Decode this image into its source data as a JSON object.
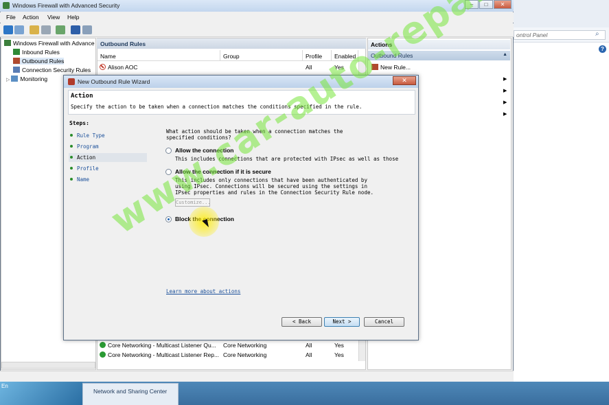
{
  "window": {
    "title": "Windows Firewall with Advanced Security",
    "controls": {
      "minimize": "–",
      "maximize": "□",
      "close": "✕"
    }
  },
  "menu": [
    "File",
    "Action",
    "View",
    "Help"
  ],
  "background_window": {
    "search_placeholder": "ontrol Panel",
    "help": "?"
  },
  "tree": {
    "root": "Windows Firewall with Advance",
    "items": [
      "Inbound Rules",
      "Outbound Rules",
      "Connection Security Rules",
      "Monitoring"
    ]
  },
  "center": {
    "header": "Outbound Rules",
    "columns": [
      "Name",
      "Group",
      "Profile",
      "Enabled"
    ],
    "rows_top": [
      {
        "name": "Alison AOC",
        "group": "",
        "profile": "All",
        "enabled": "Yes"
      }
    ],
    "rows_bottom": [
      {
        "name": "Core Networking - Multicast Listener Qu...",
        "group": "Core Networking",
        "profile": "All",
        "enabled": "Yes"
      },
      {
        "name": "Core Networking - Multicast Listener Rep...",
        "group": "Core Networking",
        "profile": "All",
        "enabled": "Yes"
      }
    ]
  },
  "actions": {
    "header": "Actions",
    "section": "Outbound Rules",
    "items": [
      "New Rule..."
    ]
  },
  "dialog": {
    "title": "New Outbound Rule Wizard",
    "close": "✕",
    "page_title": "Action",
    "page_desc": "Specify the action to be taken when a connection matches the conditions specified in the rule.",
    "steps_title": "Steps:",
    "steps": [
      "Rule Type",
      "Program",
      "Action",
      "Profile",
      "Name"
    ],
    "current_step": 2,
    "question": "What action should be taken when a connection matches the specified conditions?",
    "options": [
      {
        "label": "Allow the connection",
        "desc": "This includes connections that are protected with IPsec as well as those",
        "selected": false
      },
      {
        "label": "Allow the connection if it is secure",
        "desc": "This includes only connections that have been authenticated by using IPsec.  Connections will be secured using the settings in IPsec properties and rules in the Connection Security Rule node.",
        "selected": false
      },
      {
        "label": "Block the connection",
        "desc": "",
        "selected": true
      }
    ],
    "customize": "Customize...",
    "learn_more": "Learn more about actions",
    "buttons": {
      "back": "< Back",
      "next": "Next >",
      "cancel": "Cancel"
    }
  },
  "taskbar": {
    "lang": "En",
    "panel_label": "Network and Sharing Center"
  },
  "watermark": "www.car-auto-repair.com"
}
